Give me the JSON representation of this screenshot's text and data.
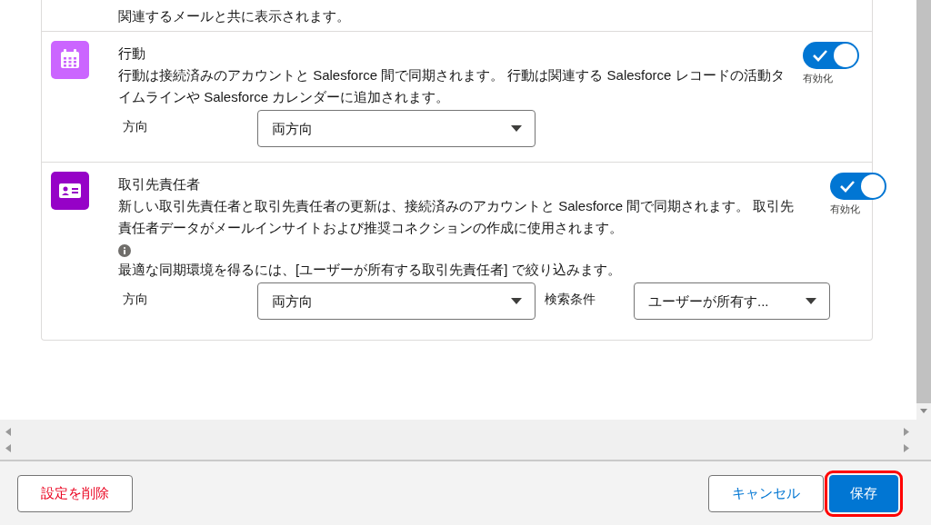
{
  "sections": [
    {
      "kind": "partial",
      "description": "関連するメールと共に表示されます。"
    },
    {
      "kind": "event",
      "color": "#cb65ff",
      "title": "行動",
      "description": "行動は接続済みのアカウントと Salesforce 間で同期されます。 行動は関連する Salesforce レコードの活動タイムラインや Salesforce カレンダーに追加されます。",
      "toggle": {
        "on": true,
        "label": "有効化"
      },
      "fields": [
        {
          "label": "方向",
          "value": "両方向"
        }
      ]
    },
    {
      "kind": "contact",
      "color": "#9602c7",
      "title": "取引先責任者",
      "description": "新しい取引先責任者と取引先責任者の更新は、接続済みのアカウントと Salesforce 間で同期されます。 取引先責任者データがメールインサイトおよび推奨コネクションの作成に使用されます。",
      "note": "最適な同期環境を得るには、[ユーザーが所有する取引先責任者] で絞り込みます。",
      "toggle": {
        "on": true,
        "label": "有効化"
      },
      "fields": [
        {
          "label": "方向",
          "value": "両方向"
        },
        {
          "label": "検索条件",
          "value": "ユーザーが所有す..."
        }
      ]
    }
  ],
  "footer": {
    "buttons": [
      {
        "kind": "destructive",
        "label": "設定を削除",
        "highlighted": false
      },
      {
        "kind": "neutral",
        "label": "キャンセル",
        "highlighted": false
      },
      {
        "kind": "brand",
        "label": "保存",
        "highlighted": true
      }
    ]
  }
}
